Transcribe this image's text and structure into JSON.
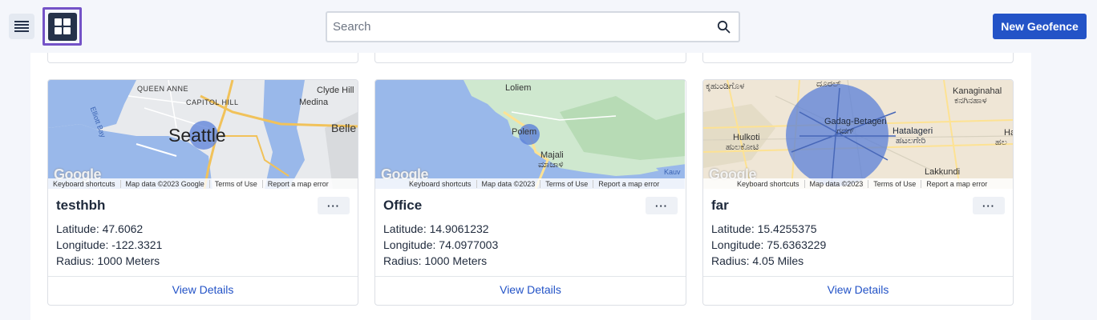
{
  "header": {
    "search_placeholder": "Search",
    "new_button": "New Geofence"
  },
  "colors": {
    "accent": "#2353c7",
    "selected_outline": "#7452c7",
    "dark_button": "#25324a"
  },
  "cards": [
    {
      "name": "testhbh",
      "latitude": "Latitude: 47.6062",
      "longitude": "Longitude: -122.3321",
      "radius": "Radius: 1000 Meters",
      "view": "View Details",
      "more": "···",
      "map": {
        "logo": "Google",
        "attribution": [
          "Keyboard shortcuts",
          "Map data ©2023 Google",
          "Terms of Use",
          "Report a map error"
        ],
        "labels": [
          "QUEEN ANNE",
          "CAPITOL HILL",
          "Clyde Hill",
          "Medina",
          "Belle",
          "Elliott Bay",
          "Seattle"
        ]
      }
    },
    {
      "name": "Office",
      "latitude": "Latitude: 14.9061232",
      "longitude": "Longitude: 74.0977003",
      "radius": "Radius: 1000 Meters",
      "view": "View Details",
      "more": "···",
      "map": {
        "logo": "Google",
        "attribution": [
          "Keyboard shortcuts",
          "Map data ©2023",
          "Terms of Use",
          "Report a map error"
        ],
        "labels": [
          "Loliem",
          "Polem",
          "Majali",
          "ಮಾಜಾಳಿ",
          "Kauv"
        ]
      }
    },
    {
      "name": "far",
      "latitude": "Latitude: 15.4255375",
      "longitude": "Longitude: 75.6363229",
      "radius": "Radius: 4.05 Miles",
      "view": "View Details",
      "more": "···",
      "map": {
        "logo": "Google",
        "attribution": [
          "Keyboard shortcuts",
          "Map data ©2023",
          "Terms of Use",
          "Report a map error"
        ],
        "labels": [
          "ಕ್ಕಹುಂಡಿಗೊಳ",
          "ದೂರಲ್",
          "Kanaginahal",
          "ಕನಗಿನಹಾಳ",
          "Gadag-Betageri",
          "ಗದಗ್",
          "Hatalageri",
          "ಹಟಲಗೇರಿ",
          "Hulkoti",
          "ಹುಲಕೋಟಿ",
          "Ha",
          "ಹಲ",
          "Lakkundi"
        ]
      }
    }
  ]
}
